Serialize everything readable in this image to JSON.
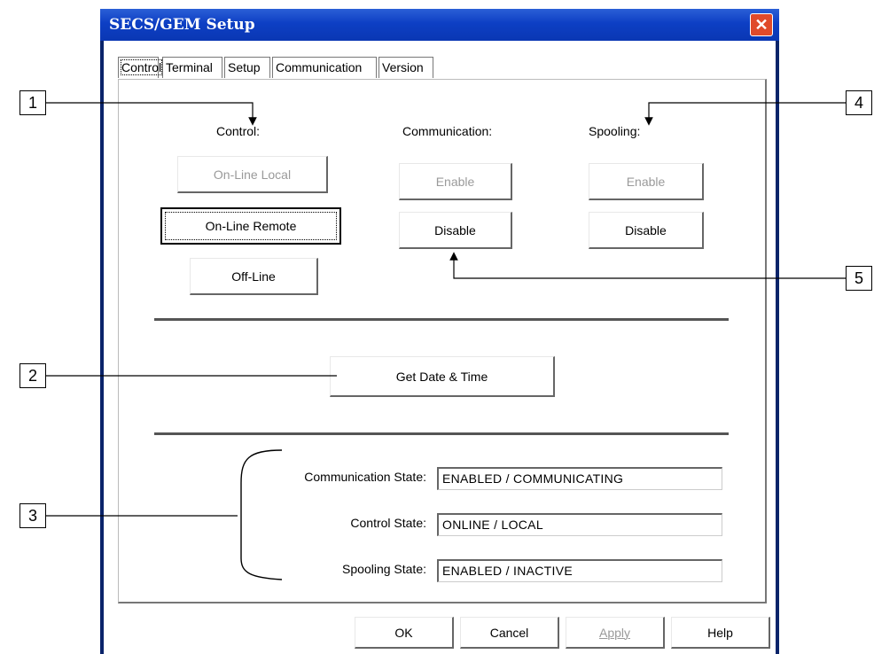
{
  "window": {
    "title": "SECS/GEM Setup",
    "close_glyph": "✕"
  },
  "tabs": [
    {
      "label": "Control"
    },
    {
      "label": "Terminal"
    },
    {
      "label": "Setup"
    },
    {
      "label": "Communication"
    },
    {
      "label": "Version"
    }
  ],
  "control": {
    "heading": "Control:",
    "online_local": "On-Line Local",
    "online_remote": "On-Line Remote",
    "offline": "Off-Line"
  },
  "communication": {
    "heading": "Communication:",
    "enable": "Enable",
    "disable": "Disable"
  },
  "spooling": {
    "heading": "Spooling:",
    "enable": "Enable",
    "disable": "Disable"
  },
  "get_date_time": "Get Date & Time",
  "states": {
    "communication_label": "Communication State:",
    "communication_value": "ENABLED / COMMUNICATING",
    "control_label": "Control State:",
    "control_value": "ONLINE / LOCAL",
    "spooling_label": "Spooling State:",
    "spooling_value": "ENABLED / INACTIVE"
  },
  "footer": {
    "ok": "OK",
    "cancel": "Cancel",
    "apply": "Apply",
    "help": "Help"
  },
  "callouts": [
    "1",
    "2",
    "3",
    "4",
    "5"
  ]
}
